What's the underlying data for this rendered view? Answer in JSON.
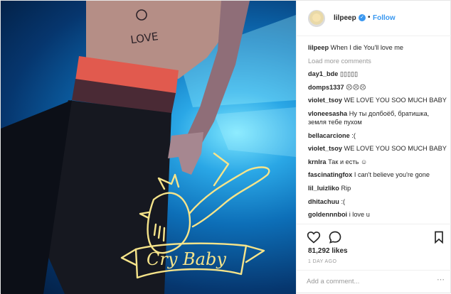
{
  "post": {
    "username": "lilpeep",
    "follow_label": "Follow",
    "dot": "•",
    "verified_glyph": "✓"
  },
  "comments": {
    "caption_user": "lilpeep",
    "caption_text": "When I die You'll love me",
    "load_more": "Load more comments",
    "items": [
      {
        "user": "day1_bde",
        "text": "▯▯▯▯▯"
      },
      {
        "user": "domps1337",
        "text": "☹☹☹"
      },
      {
        "user": "violet_tsoy",
        "text": "WE LOVE YOU SOO MUCH BABY"
      },
      {
        "user": "vloneesasha",
        "text": "Ну ты долбоёб, братишка, земля тебе пухом"
      },
      {
        "user": "bellacarcione",
        "text": ":("
      },
      {
        "user": "violet_tsoy",
        "text": "WE LOVE YOU SOO MUCH BABY"
      },
      {
        "user": "krnlra",
        "text": "Так и есть ☺"
      },
      {
        "user": "fascinatingfox",
        "text": "I can't believe you're gone"
      },
      {
        "user": "lil_luizliko",
        "text": "Rip"
      },
      {
        "user": "dhitachuu",
        "text": ":("
      },
      {
        "user": "goldennnboi",
        "text": "i love u"
      }
    ]
  },
  "actions": {
    "likes": "81,292 likes",
    "time": "1 DAY AGO",
    "icons": [
      "heart-icon",
      "comment-icon",
      "bookmark-icon",
      "more-options-icon"
    ]
  },
  "add_comment": {
    "placeholder": "Add a comment..."
  },
  "photo": {
    "tattoo_text": "Cry Baby",
    "chest_text": "LOVE"
  }
}
